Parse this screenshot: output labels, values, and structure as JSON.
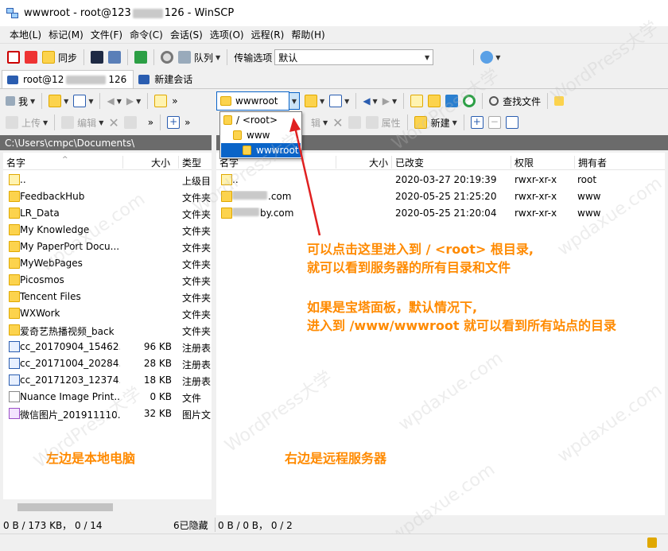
{
  "window": {
    "title": "wwwroot - root@123.xx.xx.126 - WinSCP",
    "title_prefix": "wwwroot - root@123",
    "title_suffix": "126 - WinSCP"
  },
  "menu": [
    "本地(L)",
    "标记(M)",
    "文件(F)",
    "命令(C)",
    "会话(S)",
    "选项(O)",
    "远程(R)",
    "帮助(H)"
  ],
  "toolbar": {
    "sync_label": "同步",
    "queue_label": "队列",
    "transfer_options_label": "传输选项",
    "transfer_preset": "默认"
  },
  "tabs": {
    "session_prefix": "root@12",
    "session_suffix": "126",
    "new_session": "新建会话"
  },
  "local": {
    "drive_label": "我",
    "upload_label": "上传",
    "edit_label": "编辑",
    "path": "C:\\Users\\cmpc\\Documents\\",
    "columns": {
      "name": "名字",
      "size": "大小",
      "type": "类型"
    },
    "files": [
      {
        "name": "..",
        "size": "",
        "type": "上级目",
        "icon": "up"
      },
      {
        "name": "FeedbackHub",
        "size": "",
        "type": "文件夹",
        "icon": "folder"
      },
      {
        "name": "LR_Data",
        "size": "",
        "type": "文件夹",
        "icon": "folder"
      },
      {
        "name": "My Knowledge",
        "size": "",
        "type": "文件夹",
        "icon": "folder"
      },
      {
        "name": "My PaperPort Docu...",
        "size": "",
        "type": "文件夹",
        "icon": "folder"
      },
      {
        "name": "MyWebPages",
        "size": "",
        "type": "文件夹",
        "icon": "folder"
      },
      {
        "name": "Picosmos",
        "size": "",
        "type": "文件夹",
        "icon": "folder"
      },
      {
        "name": "Tencent Files",
        "size": "",
        "type": "文件夹",
        "icon": "folder"
      },
      {
        "name": "WXWork",
        "size": "",
        "type": "文件夹",
        "icon": "folder"
      },
      {
        "name": "爱奇艺热播视频_back",
        "size": "",
        "type": "文件夹",
        "icon": "folder"
      },
      {
        "name": "cc_20170904_15462...",
        "size": "96 KB",
        "type": "注册表",
        "icon": "reg"
      },
      {
        "name": "cc_20171004_20284...",
        "size": "28 KB",
        "type": "注册表",
        "icon": "reg"
      },
      {
        "name": "cc_20171203_12374...",
        "size": "18 KB",
        "type": "注册表",
        "icon": "reg"
      },
      {
        "name": "Nuance Image Print...",
        "size": "0 KB",
        "type": "文件",
        "icon": "doc"
      },
      {
        "name": "微信图片_201911110...",
        "size": "32 KB",
        "type": "图片文",
        "icon": "img"
      }
    ],
    "status": "0 B / 173 KB， 0 / 14",
    "hidden": "6已隐藏"
  },
  "remote": {
    "current_dir": "wwwroot",
    "find_files_label": "查找文件",
    "properties_label": "属性",
    "new_label": "新建",
    "dropdown": [
      {
        "label": "/ <root>"
      },
      {
        "label": "www"
      },
      {
        "label": "wwwroot"
      }
    ],
    "path_fragment": "/",
    "columns": {
      "name": "名字",
      "size": "大小",
      "changed": "已改变",
      "rights": "权限",
      "owner": "拥有者"
    },
    "files": [
      {
        "name": "..",
        "changed": "2020-03-27 20:19:39",
        "rights": "rwxr-xr-x",
        "owner": "root",
        "icon": "up"
      },
      {
        "name": ".com",
        "changed": "2020-05-25 21:25:20",
        "rights": "rwxr-xr-x",
        "owner": "www",
        "icon": "folder"
      },
      {
        "name": "by.com",
        "changed": "2020-05-25 21:20:04",
        "rights": "rwxr-xr-x",
        "owner": "www",
        "icon": "folder"
      }
    ],
    "status": "0 B / 0 B， 0 / 2"
  },
  "annotations": {
    "line1": "可以点击这里进入到 / <root> 根目录,",
    "line2": "就可以看到服务器的所有目录和文件",
    "line3": "如果是宝塔面板，默认情况下,",
    "line4": "进入到 /www/wwwroot 就可以看到所有站点的目录",
    "left_label": "左边是本地电脑",
    "right_label": "右边是远程服务器"
  },
  "watermarks": [
    "WordPress大学",
    "wpdaxue.com"
  ],
  "colors": {
    "annotation": "#ff8a00",
    "arrow": "#e02020",
    "selection": "#0a64c8",
    "path_bar": "#6b6b6b"
  }
}
